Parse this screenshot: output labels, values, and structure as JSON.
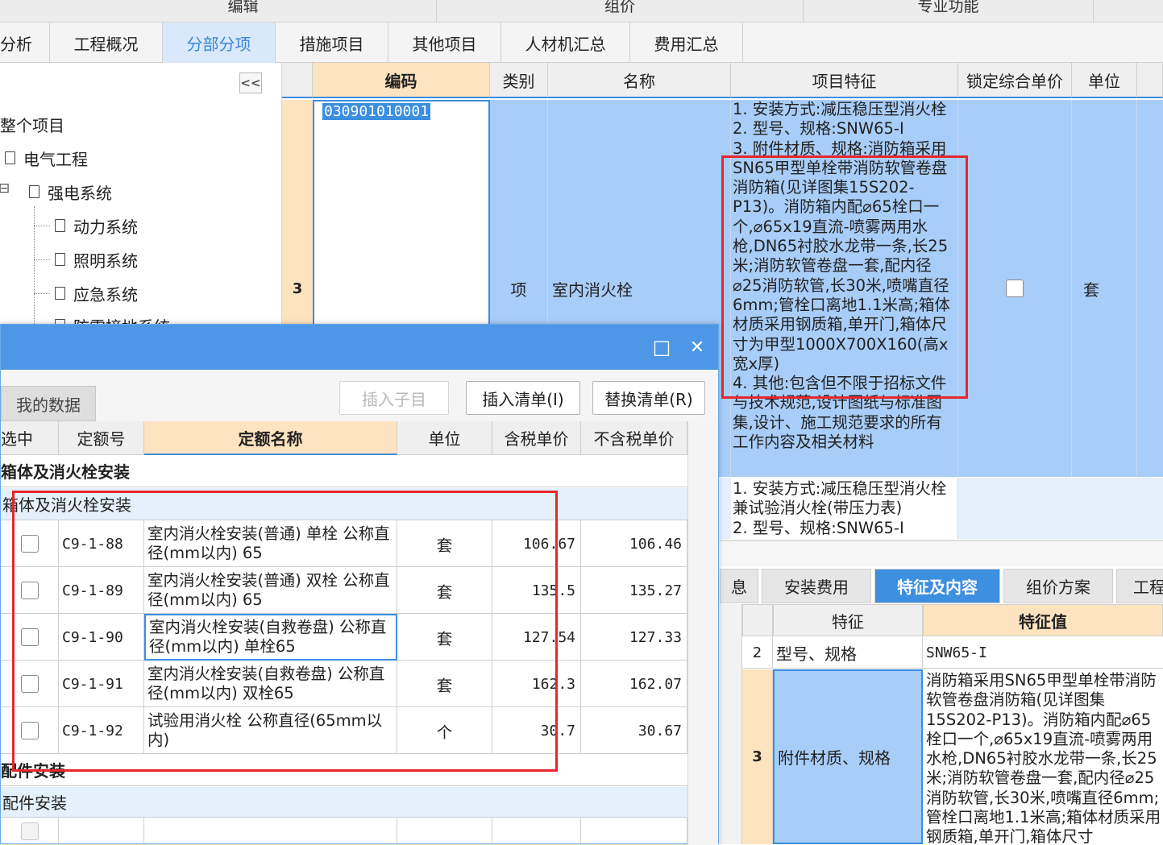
{
  "ribbon": {
    "groups": [
      "编辑",
      "组价",
      "专业功能"
    ]
  },
  "tabs": [
    "分析",
    "工程概况",
    "分部分项",
    "措施项目",
    "其他项目",
    "人材机汇总",
    "费用汇总"
  ],
  "active_tab": "分部分项",
  "tree": {
    "collapse_label": "<<",
    "items": [
      "整个项目",
      "电气工程",
      "强电系统",
      "动力系统",
      "照明系统",
      "应急系统",
      "防雷接地系统"
    ],
    "expand_toggle": "⊟"
  },
  "grid": {
    "headers": [
      "编码",
      "类别",
      "名称",
      "项目特征",
      "锁定综合单价",
      "单位"
    ],
    "row": {
      "num": "3",
      "code": "030901010001",
      "type": "项",
      "name": "室内消火栓",
      "features": [
        "1. 安装方式:减压稳压型消火栓",
        "2. 型号、规格:SNW65-I",
        "3. 附件材质、规格:消防箱采用SN65甲型单栓带消防软管卷盘消防箱(见详图集15S202-P13)。消防箱内配⌀65栓口一个,⌀65x19直流-喷雾两用水枪,DN65衬胶水龙带一条,长25米;消防软管卷盘一套,配内径⌀25消防软管,长30米,喷嘴直径6mm;管栓口离地1.1米高;箱体材质采用钢质箱,单开门,箱体尺寸为甲型1000X700X160(高x宽x厚)",
        "4. 其他:包含但不限于招标文件与技术规范,设计图纸与标准图集,设计、施工规范要求的所有工作内容及相关材料"
      ],
      "unit": "套"
    },
    "next_row_features": [
      "1. 安装方式:减压稳压型消火栓兼试验消火栓(带压力表)",
      "2. 型号、规格:SNW65-I"
    ]
  },
  "right_panel": {
    "tabs": [
      "息",
      "安装费用",
      "特征及内容",
      "组价方案",
      "工程"
    ],
    "active_tab": "特征及内容",
    "headers": [
      "特征",
      "特征值"
    ],
    "rows": [
      {
        "num": "2",
        "feature": "型号、规格",
        "value": "SNW65-I"
      },
      {
        "num": "3",
        "feature": "附件材质、规格",
        "value": "消防箱采用SN65甲型单栓带消防软管卷盘消防箱(见详图集15S202-P13)。消防箱内配⌀65栓口一个,⌀65x19直流-喷雾两用水枪,DN65衬胶水龙带一条,长25米;消防软管卷盘一套,配内径⌀25消防软管,长30米,喷嘴直径6mm;管栓口离地1.1米高;箱体材质采用钢质箱,单开门,箱体尺寸"
      }
    ]
  },
  "dialog": {
    "maximize": "□",
    "close": "✕",
    "tab": "我的数据",
    "buttons": [
      "插入子目",
      "插入清单(I)",
      "替换清单(R)"
    ],
    "headers": [
      "选中",
      "定额号",
      "定额名称",
      "单位",
      "含税单价",
      "不含税单价"
    ],
    "group1": "箱体及消火栓安装",
    "subgroup1": "箱体及消火栓安装",
    "rows": [
      {
        "code": "C9-1-88",
        "name": "室内消火栓安装(普通) 单栓 公称直径(mm以内) 65",
        "unit": "套",
        "tax_price": "106.67",
        "notax_price": "106.46"
      },
      {
        "code": "C9-1-89",
        "name": "室内消火栓安装(普通) 双栓 公称直径(mm以内) 65",
        "unit": "套",
        "tax_price": "135.5",
        "notax_price": "135.27"
      },
      {
        "code": "C9-1-90",
        "name": "室内消火栓安装(自救卷盘) 公称直径(mm以内) 单栓65",
        "unit": "套",
        "tax_price": "127.54",
        "notax_price": "127.33"
      },
      {
        "code": "C9-1-91",
        "name": "室内消火栓安装(自救卷盘) 公称直径(mm以内) 双栓65",
        "unit": "套",
        "tax_price": "162.3",
        "notax_price": "162.07"
      },
      {
        "code": "C9-1-92",
        "name": "试验用消火栓 公称直径(65mm以内)",
        "unit": "个",
        "tax_price": "30.7",
        "notax_price": "30.67"
      }
    ],
    "group2": "配件安装",
    "subgroup2": "配件安装"
  },
  "colors": {
    "accent": "#3d8fe0",
    "selected_row": "#a8cdf8",
    "highlight_header": "#fde3bf",
    "annotation": "#e8262b"
  }
}
